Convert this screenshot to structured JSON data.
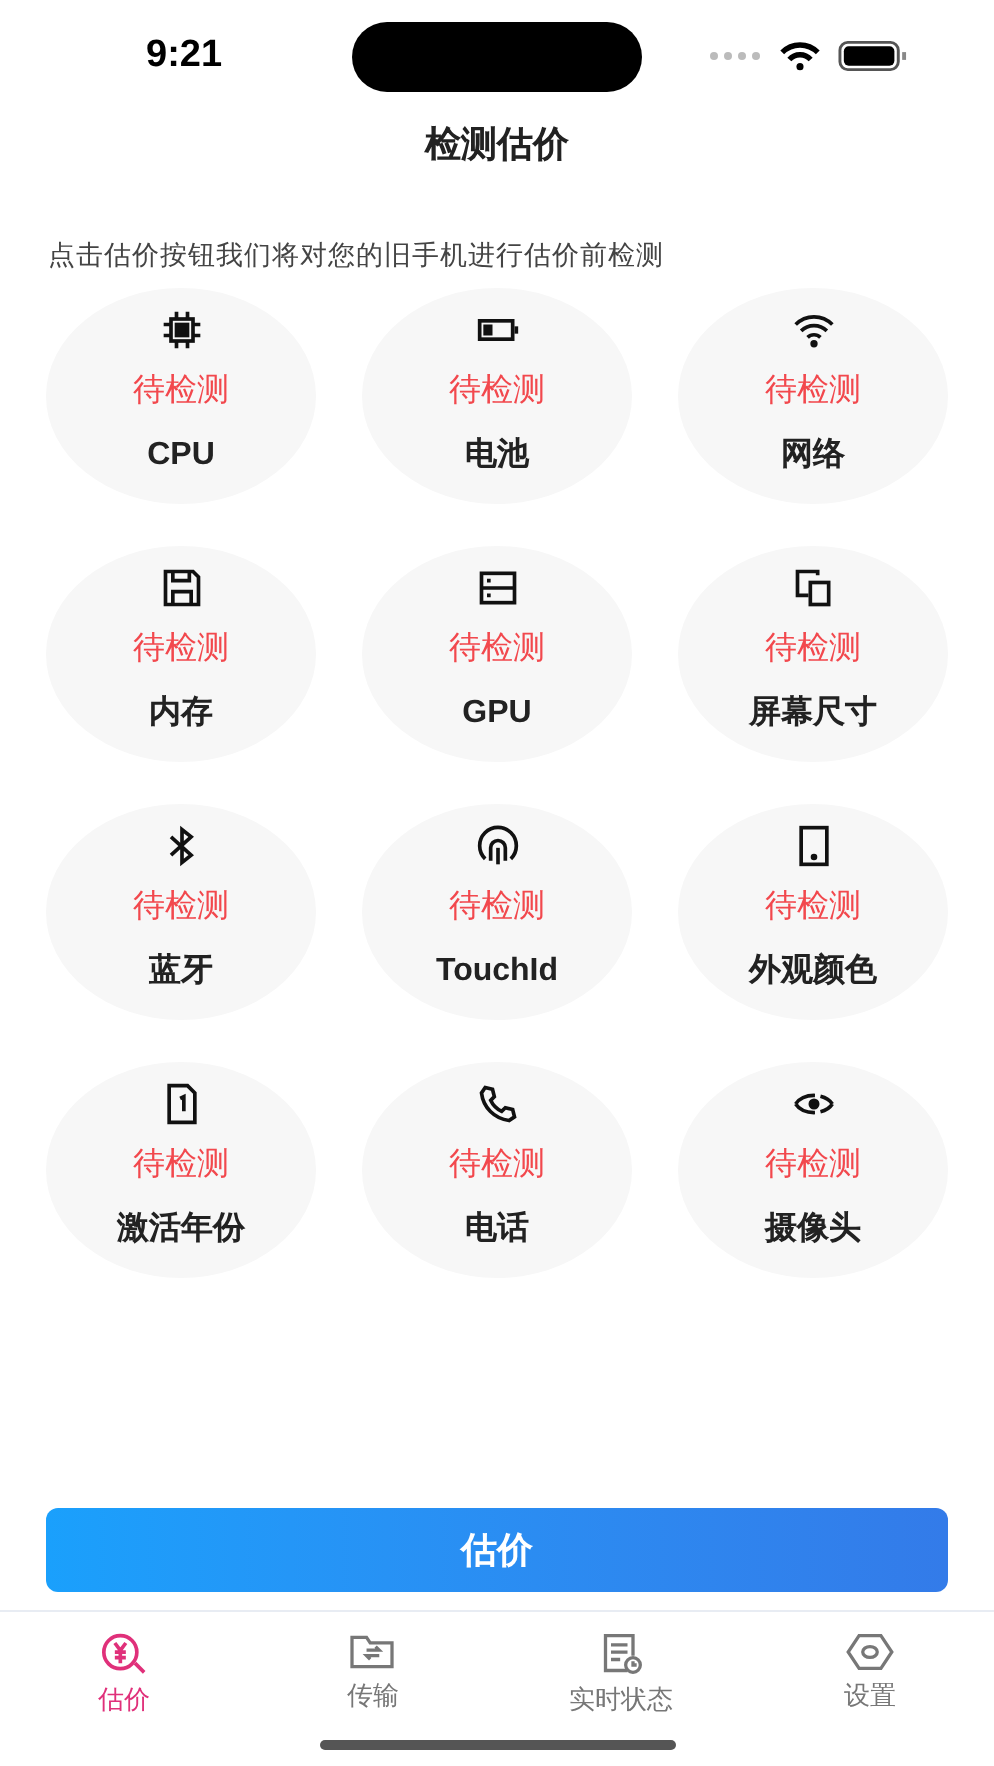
{
  "status_bar": {
    "time": "9:21"
  },
  "header": {
    "title": "检测估价"
  },
  "hint": "点击估价按钮我们将对您的旧手机进行估价前检测",
  "checks": [
    {
      "status": "待检测",
      "label": "CPU"
    },
    {
      "status": "待检测",
      "label": "电池"
    },
    {
      "status": "待检测",
      "label": "网络"
    },
    {
      "status": "待检测",
      "label": "内存"
    },
    {
      "status": "待检测",
      "label": "GPU"
    },
    {
      "status": "待检测",
      "label": "屏幕尺寸"
    },
    {
      "status": "待检测",
      "label": "蓝牙"
    },
    {
      "status": "待检测",
      "label": "TouchId"
    },
    {
      "status": "待检测",
      "label": "外观颜色"
    },
    {
      "status": "待检测",
      "label": "激活年份"
    },
    {
      "status": "待检测",
      "label": "电话"
    },
    {
      "status": "待检测",
      "label": "摄像头"
    }
  ],
  "primary_button": "估价",
  "tab_bar": [
    {
      "label": "估价",
      "selected": true
    },
    {
      "label": "传输",
      "selected": false
    },
    {
      "label": "实时状态",
      "selected": false
    },
    {
      "label": "设置",
      "selected": false
    }
  ]
}
